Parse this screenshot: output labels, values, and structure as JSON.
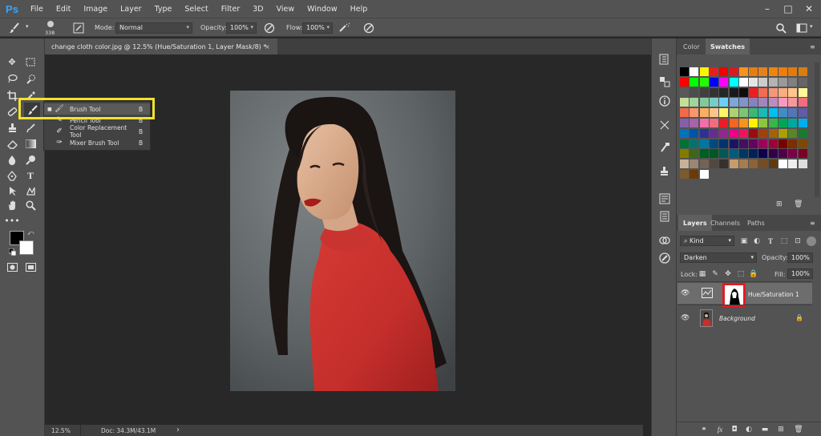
{
  "app": {
    "logo": "Ps"
  },
  "menu": [
    "File",
    "Edit",
    "Image",
    "Layer",
    "Type",
    "Select",
    "Filter",
    "3D",
    "View",
    "Window",
    "Help"
  ],
  "window_controls": {
    "minimize": "–",
    "maximize": "□",
    "close": "✕"
  },
  "options_bar": {
    "brush_size": "338",
    "mode_label": "Mode:",
    "mode_value": "Normal",
    "opacity_label": "Opacity:",
    "opacity_value": "100%",
    "flow_label": "Flow:",
    "flow_value": "100%"
  },
  "document": {
    "tab_title": "change cloth color.jpg @ 12.5% (Hue/Saturation 1, Layer Mask/8) *",
    "close": "×"
  },
  "flyout": {
    "items": [
      {
        "label": "Brush Tool",
        "key": "B",
        "icon": "brush-icon",
        "selected": true
      },
      {
        "label": "Pencil Tool",
        "key": "B",
        "icon": "pencil-icon",
        "selected": false
      },
      {
        "label": "Color Replacement Tool",
        "key": "B",
        "icon": "color-replace-icon",
        "selected": false
      },
      {
        "label": "Mixer Brush Tool",
        "key": "B",
        "icon": "mixer-brush-icon",
        "selected": false
      }
    ],
    "highlight_color": "#f2e22c"
  },
  "status": {
    "zoom": "12.5%",
    "doc": "Doc: 34.3M/43.1M",
    "arrow": "›"
  },
  "panels": {
    "color_tab": "Color",
    "swatches_tab": "Swatches",
    "layers_tab": "Layers",
    "channels_tab": "Channels",
    "paths_tab": "Paths",
    "kind_label": "Kind",
    "blend_mode": "Darken",
    "opacity_label": "Opacity:",
    "opacity_value": "100%",
    "lock_label": "Lock:",
    "fill_label": "Fill:",
    "fill_value": "100%",
    "layers": [
      {
        "name": "Hue/Saturation 1",
        "selected": true
      },
      {
        "name": "Background",
        "locked": true
      }
    ]
  },
  "swatches": [
    [
      "#000000",
      "#ffffff",
      "#fbf504",
      "#e41f22",
      "#ee0101",
      "#d71a21",
      "#f7931e",
      "#e57e11",
      "#e7821a",
      "#ec8610",
      "#ec7d10",
      "#e07c0f",
      "#d67e11"
    ],
    [
      "#ff0000",
      "#00ff00",
      "#22ff00",
      "#0000ff",
      "#ff00ff",
      "#00ffff",
      "#ffffff",
      "#e6e6e6",
      "#cccccc",
      "#b3b3b3",
      "#999999",
      "#808080",
      "#666666"
    ],
    [
      "#595959",
      "#4d4d4d",
      "#404040",
      "#333333",
      "#262626",
      "#1a1a1a",
      "#0d0d0d",
      "#ee1d24",
      "#f26c4f",
      "#f69679",
      "#f9ad81",
      "#fdc68a",
      "#fff79a"
    ],
    [
      "#c4df9b",
      "#a3d39c",
      "#82ca9c",
      "#7accc8",
      "#6dcff6",
      "#7da7d9",
      "#8393ca",
      "#8781bd",
      "#a186be",
      "#bd8cbf",
      "#f49ac1",
      "#f5989d",
      "#f26d7d"
    ],
    [
      "#f36a4a",
      "#f7976a",
      "#fbaf5d",
      "#fdc689",
      "#fff467",
      "#acd373",
      "#7cc576",
      "#3bb878",
      "#1abbb4",
      "#00bff3",
      "#438cca",
      "#5574b9",
      "#605ca8"
    ],
    [
      "#8560a8",
      "#a763a8",
      "#f06eaa",
      "#f26c7d",
      "#ed1c24",
      "#f26522",
      "#f7941d",
      "#fff200",
      "#8dc63f",
      "#39b54a",
      "#00a651",
      "#00a99d",
      "#00aeef"
    ],
    [
      "#0072bc",
      "#0054a6",
      "#2e3192",
      "#662d91",
      "#92278f",
      "#ec008c",
      "#ed145b",
      "#9e0b0f",
      "#a0410d",
      "#a36209",
      "#aba000",
      "#598527",
      "#197b30"
    ],
    [
      "#007236",
      "#00746b",
      "#0076a3",
      "#004a80",
      "#003471",
      "#1b1464",
      "#440e62",
      "#630460",
      "#9e005d",
      "#9e0039",
      "#790000",
      "#7b2e00",
      "#7d4900"
    ],
    [
      "#827b00",
      "#406618",
      "#005e20",
      "#005826",
      "#005952",
      "#005b7f",
      "#003663",
      "#002157",
      "#0d004c",
      "#32004b",
      "#4b0049",
      "#7b0046",
      "#7a0026"
    ],
    [
      "#c7b299",
      "#998675",
      "#736357",
      "#534741",
      "#37302d",
      "#c69c6d",
      "#a67c52",
      "#8c6239",
      "#754c24",
      "#603913",
      "#ffffff",
      "#eeeeee",
      "#dddddd"
    ],
    [
      "#7b5a2e",
      "#6d3a07",
      "#ffffff"
    ]
  ]
}
